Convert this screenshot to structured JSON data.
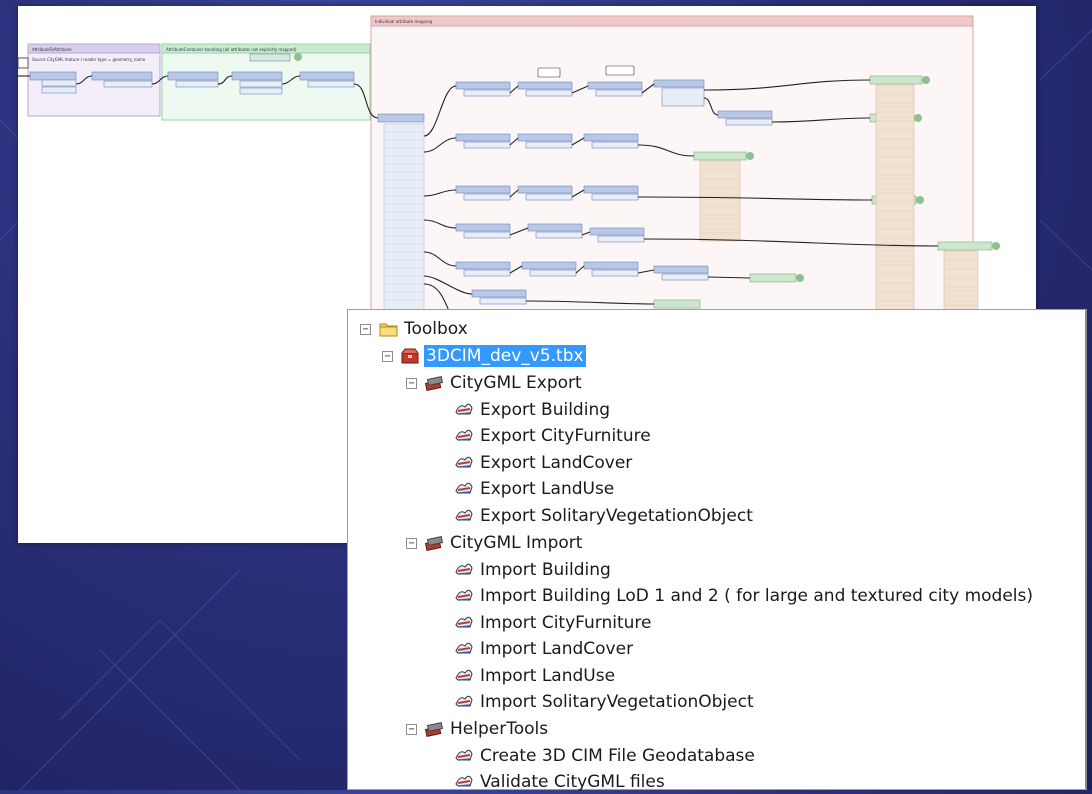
{
  "toolbox": {
    "root_label": "Toolbox",
    "file_label": "3DCIM_dev_v5.tbx",
    "groups": [
      {
        "label": "CityGML Export",
        "tools": [
          "Export Building",
          "Export CityFurniture",
          "Export LandCover",
          "Export LandUse",
          "Export SolitaryVegetationObject"
        ]
      },
      {
        "label": "CityGML Import",
        "tools": [
          "Import Building",
          "Import Building LoD 1 and 2 ( for large and textured city models)",
          "Import CityFurniture",
          "Import LandCover",
          "Import LandUse",
          "Import SolitaryVegetationObject"
        ]
      },
      {
        "label": "HelperTools",
        "tools": [
          "Create 3D CIM File Geodatabase",
          "Validate CityGML files"
        ]
      }
    ]
  },
  "icons": {
    "root": "folder-icon",
    "file": "toolbox-file-icon",
    "group": "toolset-icon",
    "tool": "script-tool-icon"
  },
  "colors": {
    "background": "#2a2f7a",
    "selection": "#3399ff",
    "bookmark_purple": "#d9cdea",
    "bookmark_green": "#c9ecd1",
    "bookmark_red": "#efc9c9",
    "transformer_blue": "#b8c8e6",
    "feature_type_green": "#8fc08f"
  }
}
